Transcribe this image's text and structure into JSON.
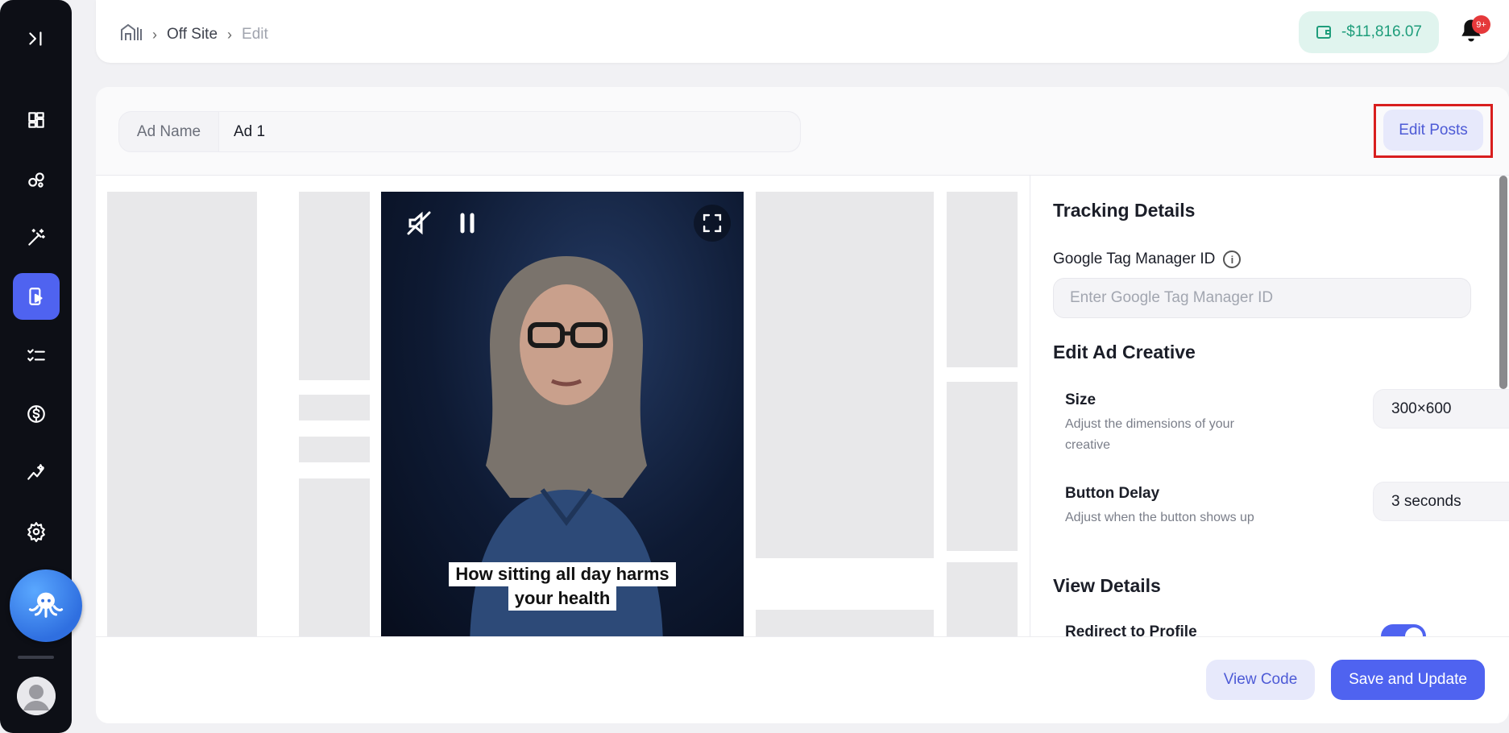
{
  "sidebar": {
    "items": [
      {
        "icon": "collapse-icon"
      },
      {
        "icon": "dashboard-icon"
      },
      {
        "icon": "circles-icon"
      },
      {
        "icon": "magic-wand-icon"
      },
      {
        "icon": "video-ad-icon",
        "active": true
      },
      {
        "icon": "checklist-icon"
      },
      {
        "icon": "dollar-icon"
      },
      {
        "icon": "analytics-icon"
      },
      {
        "icon": "settings-icon"
      }
    ],
    "logo": "octopus-logo-icon",
    "avatar": "user-avatar-icon"
  },
  "header": {
    "breadcrumb": [
      "Off Site",
      "Edit"
    ],
    "balance": "-$11,816.07",
    "notification_badge": "9+"
  },
  "ad": {
    "name_label": "Ad Name",
    "name_value": "Ad 1",
    "edit_posts_label": "Edit Posts"
  },
  "video": {
    "caption_line1": "How sitting all day harms",
    "caption_line2": "your health"
  },
  "panel": {
    "tracking_title": "Tracking Details",
    "gtm_label": "Google Tag Manager ID",
    "gtm_placeholder": "Enter Google Tag Manager ID",
    "gtm_value": "",
    "creative_title": "Edit Ad Creative",
    "size_title": "Size",
    "size_desc": "Adjust the dimensions of your creative",
    "size_value": "300×600",
    "delay_title": "Button Delay",
    "delay_desc": "Adjust when the button shows up",
    "delay_value": "3 seconds",
    "view_title": "View Details",
    "redirect_label": "Redirect to Profile",
    "redirect_on": true
  },
  "footer": {
    "view_code_label": "View Code",
    "save_label": "Save and Update"
  },
  "colors": {
    "accent": "#4f63f0",
    "sidebar_bg": "#0d0f16",
    "balance_text": "#1e9d7b",
    "highlight_border": "#d81e1e"
  }
}
